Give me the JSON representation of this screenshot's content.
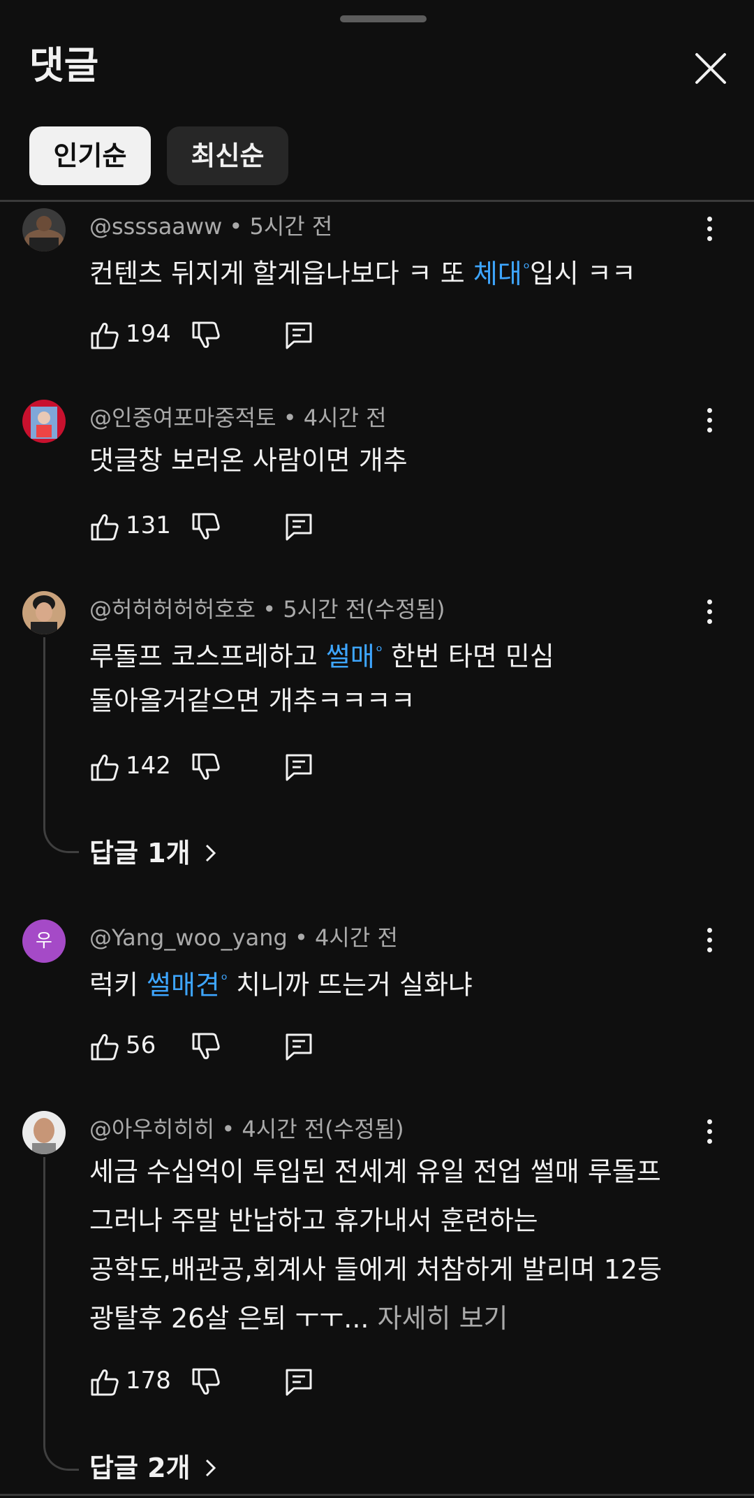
{
  "header": {
    "title": "댓글"
  },
  "sort": {
    "popular": "인기순",
    "newest": "최신순"
  },
  "comments": [
    {
      "author": "@ssssaaww",
      "time": "5시간 전",
      "text_before": "컨텐츠 뒤지게 할게읍나보다 ㅋ 또 ",
      "link": "체대",
      "text_after": "입시 ㅋㅋ",
      "likes": "194"
    },
    {
      "author": "@인중여포마중적토",
      "time": "4시간 전",
      "text": "댓글창 보러온 사람이면 개추",
      "likes": "131"
    },
    {
      "author": "@허허허허허호호",
      "time": "5시간 전(수정됨)",
      "text_before": "루돌프 코스프레하고 ",
      "link": "썰매",
      "text_after": " 한번 타면 민심",
      "line2": "돌아올거같으면 개추ㅋㅋㅋㅋ",
      "likes": "142",
      "replies": "답글 1개"
    },
    {
      "author": "@Yang_woo_yang",
      "avatar_letter": "우",
      "avatar_color": "#a54ac7",
      "time": "4시간 전",
      "text_before": "럭키 ",
      "link": "썰매견",
      "text_after": " 치니까 뜨는거 실화냐",
      "likes": "56"
    },
    {
      "author": "@아우히히히",
      "time": "4시간 전(수정됨)",
      "line1": "세금 수십억이 투입된 전세계 유일 전업 썰매 루돌프",
      "line2": "그러나 주말 반납하고 휴가내서 훈련하는",
      "line3": "공학도,배관공,회계사 들에게 처참하게 발리며 12등",
      "line4": "광탈후 26살 은퇴 ㅜㅜ...",
      "more": "자세히 보기",
      "likes": "178",
      "replies": "답글 2개"
    }
  ],
  "colors": {
    "link": "#3ea6ff",
    "background": "#0f0f0f"
  }
}
